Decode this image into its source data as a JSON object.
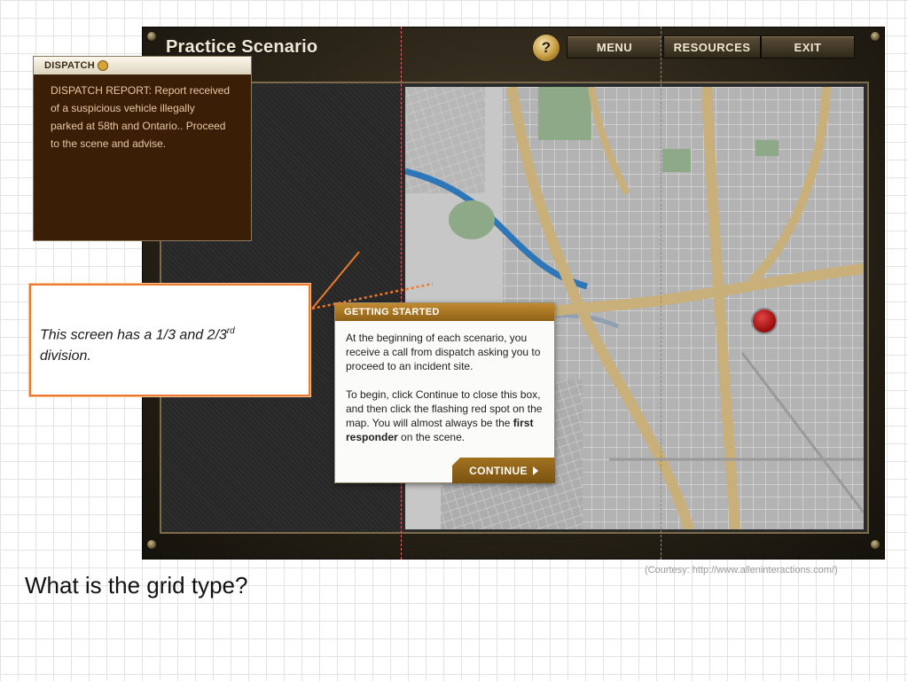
{
  "app": {
    "title": "Practice Scenario",
    "help_label": "?",
    "nav": {
      "menu": "MENU",
      "resources": "RESOURCES",
      "exit": "EXIT"
    }
  },
  "dispatch": {
    "title": "DISPATCH",
    "lines": [
      "DISPATCH REPORT: Report received",
      "of a suspicious vehicle illegally",
      "parked at 58th and Ontario.. Proceed",
      "to the scene and advise."
    ]
  },
  "getting_started": {
    "title": "GETTING STARTED",
    "para1": "At the beginning of each scenario, you receive a call from dispatch asking you to proceed to an incident site.",
    "para2_before": "To begin, click Continue to close this box, and then click the flashing red spot on the map. You will almost always be the ",
    "para2_bold": "first responder",
    "para2_after": " on the scene.",
    "continue_label": "CONTINUE"
  },
  "callout": {
    "line1_prefix": "This screen has a 1/3 and 2/3",
    "superscript": "rd",
    "line2": "division."
  },
  "question": "What is the grid type?",
  "courtesy": "(Courtesy: http://www.alleninteractions.com/)",
  "colors": {
    "callout_border": "#ec7a2a",
    "guide_line": "#e8626d",
    "red_spot": "#b31414",
    "dispatch_bg": "#3a1e06",
    "header_gold": "#a97a26"
  }
}
